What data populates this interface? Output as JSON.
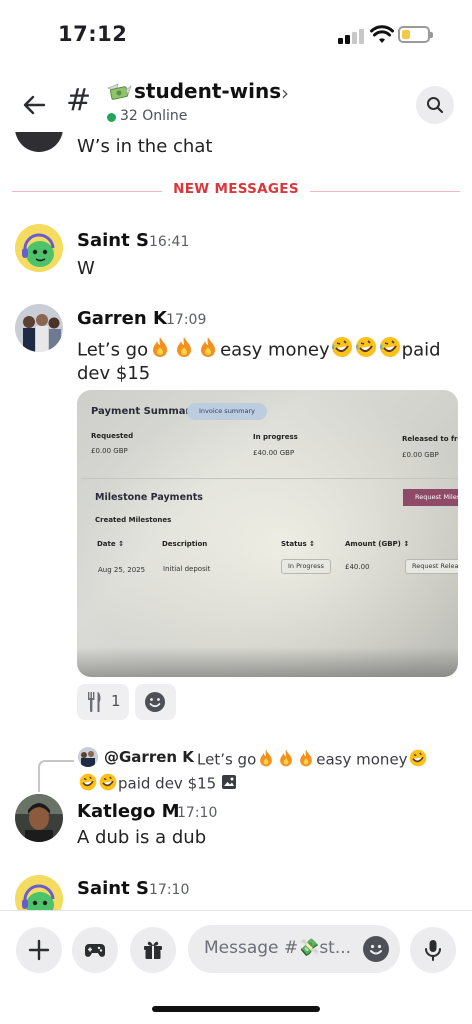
{
  "status_bar": {
    "time": "17:12"
  },
  "header": {
    "channel_name": "student-wins",
    "online": "32 Online"
  },
  "divider": {
    "label": "NEW MESSAGES"
  },
  "messages": [
    {
      "text": "W’s in the chat"
    },
    {
      "username": "Saint S",
      "time": "16:41",
      "text": "W"
    },
    {
      "username": "Garren K",
      "time": "17:09",
      "text_start": "Let’s go",
      "text_mid": "easy money",
      "text_end": "paid",
      "text_line2": "dev $15",
      "reaction_count": "1"
    },
    {
      "reply_user": "@Garren K",
      "reply_text_start": "Let’s go",
      "reply_text_mid": "easy money",
      "reply_text_end": "paid dev $15",
      "username": "Katlego M",
      "time": "17:10",
      "text": "A dub is a dub"
    },
    {
      "username": "Saint S",
      "time": "17:10"
    }
  ],
  "attachment": {
    "title": "Payment Summary",
    "invoice_button": "Invoice summary",
    "requested_label": "Requested",
    "requested_value": "£0.00 GBP",
    "in_progress_label": "In progress",
    "in_progress_value": "£40.00 GBP",
    "released_label": "Released to freela",
    "released_value": "£0.00 GBP",
    "milestone_title": "Milestone Payments",
    "milestone_button": "Request Milest",
    "created_label": "Created Milestones",
    "col_date": "Date ↕",
    "col_description": "Description",
    "col_status": "Status ↕",
    "col_amount": "Amount (GBP) ↕",
    "row_date": "Aug 25, 2025",
    "row_description": "Initial deposit",
    "row_status": "In Progress",
    "row_amount": "£40.00",
    "row_action": "Request Release"
  },
  "composer": {
    "placeholder": "Message #💸st..."
  }
}
